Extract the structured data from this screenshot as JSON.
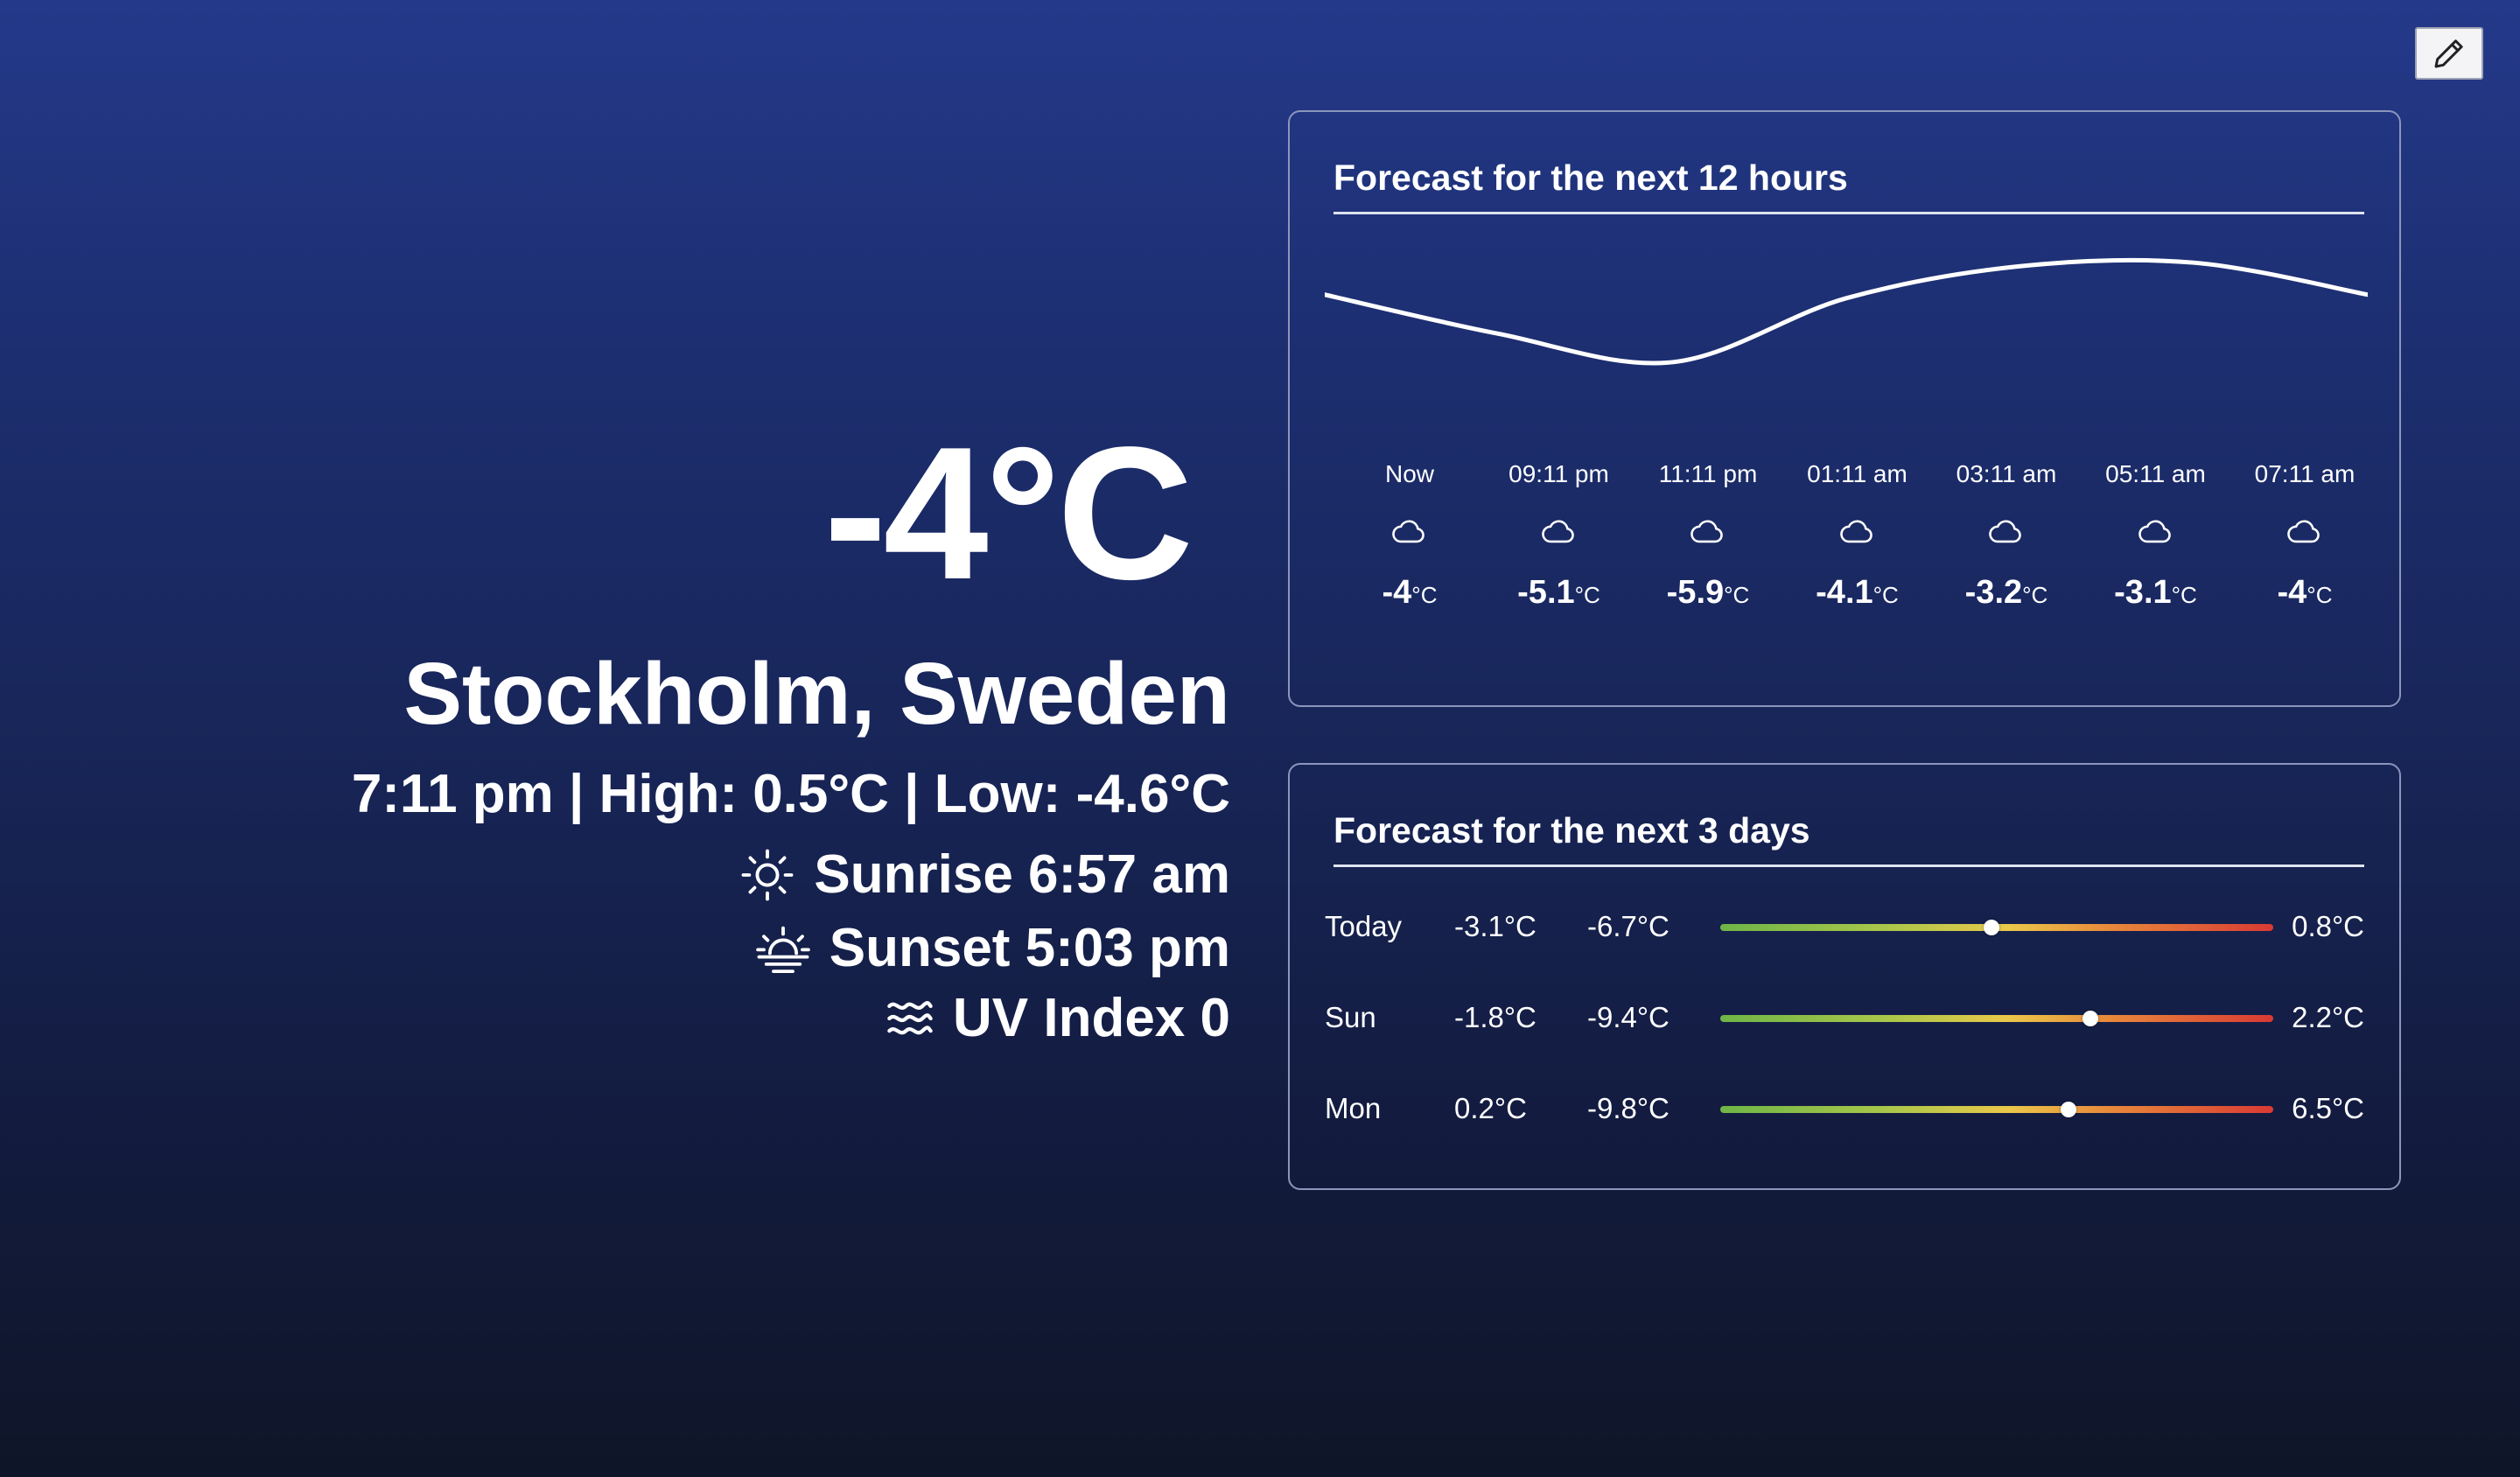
{
  "current": {
    "temperature": "-4°C",
    "location": "Stockholm, Swedeн",
    "summary": "7:11 pm | High: 0.5°C | Low: -4.6°C",
    "sunrise": "Sunrise 6:57 am",
    "sunset": "Sunset 5:03 pm",
    "uv_index": "UV Index 0"
  },
  "hourly": {
    "title": "Forecast for the next 12 hours",
    "items": [
      {
        "time": "Now",
        "temp": "-4",
        "value": -4,
        "icon": "cloud-icon"
      },
      {
        "time": "09:11 pm",
        "temp": "-5.1",
        "value": -5.1,
        "icon": "cloud-icon"
      },
      {
        "time": "11:11 pm",
        "temp": "-5.9",
        "value": -5.9,
        "icon": "cloud-icon"
      },
      {
        "time": "01:11 am",
        "temp": "-4.1",
        "value": -4.1,
        "icon": "cloud-icon"
      },
      {
        "time": "03:11 am",
        "temp": "-3.2",
        "value": -3.2,
        "icon": "cloud-icon"
      },
      {
        "time": "05:11 am",
        "temp": "-3.1",
        "value": -3.1,
        "icon": "cloud-icon"
      },
      {
        "time": "07:11 am",
        "temp": "-4",
        "value": -4,
        "icon": "cloud-icon"
      }
    ],
    "unit": "°C"
  },
  "daily": {
    "title": "Forecast for the next 3 days",
    "items": [
      {
        "day": "Today",
        "value1": "-3.1°C",
        "min": "-6.7°C",
        "max": "0.8°C",
        "marker": 0.49
      },
      {
        "day": "Sun",
        "value1": "-1.8°C",
        "min": "-9.4°C",
        "max": "2.2°C",
        "marker": 0.67
      },
      {
        "day": "Mon",
        "value1": "0.2°C",
        "min": "-9.8°C",
        "max": "6.5°C",
        "marker": 0.63
      }
    ]
  },
  "colors": {
    "bg_top": "#24398a",
    "bg_bottom": "#0f1528",
    "range_green": "#6fb547",
    "range_yellow": "#eac84a",
    "range_red": "#d93a34"
  },
  "icons": {
    "edit": "pencil-icon",
    "sunrise": "sun-icon",
    "sunset": "sunset-icon",
    "uv": "waves-icon"
  }
}
